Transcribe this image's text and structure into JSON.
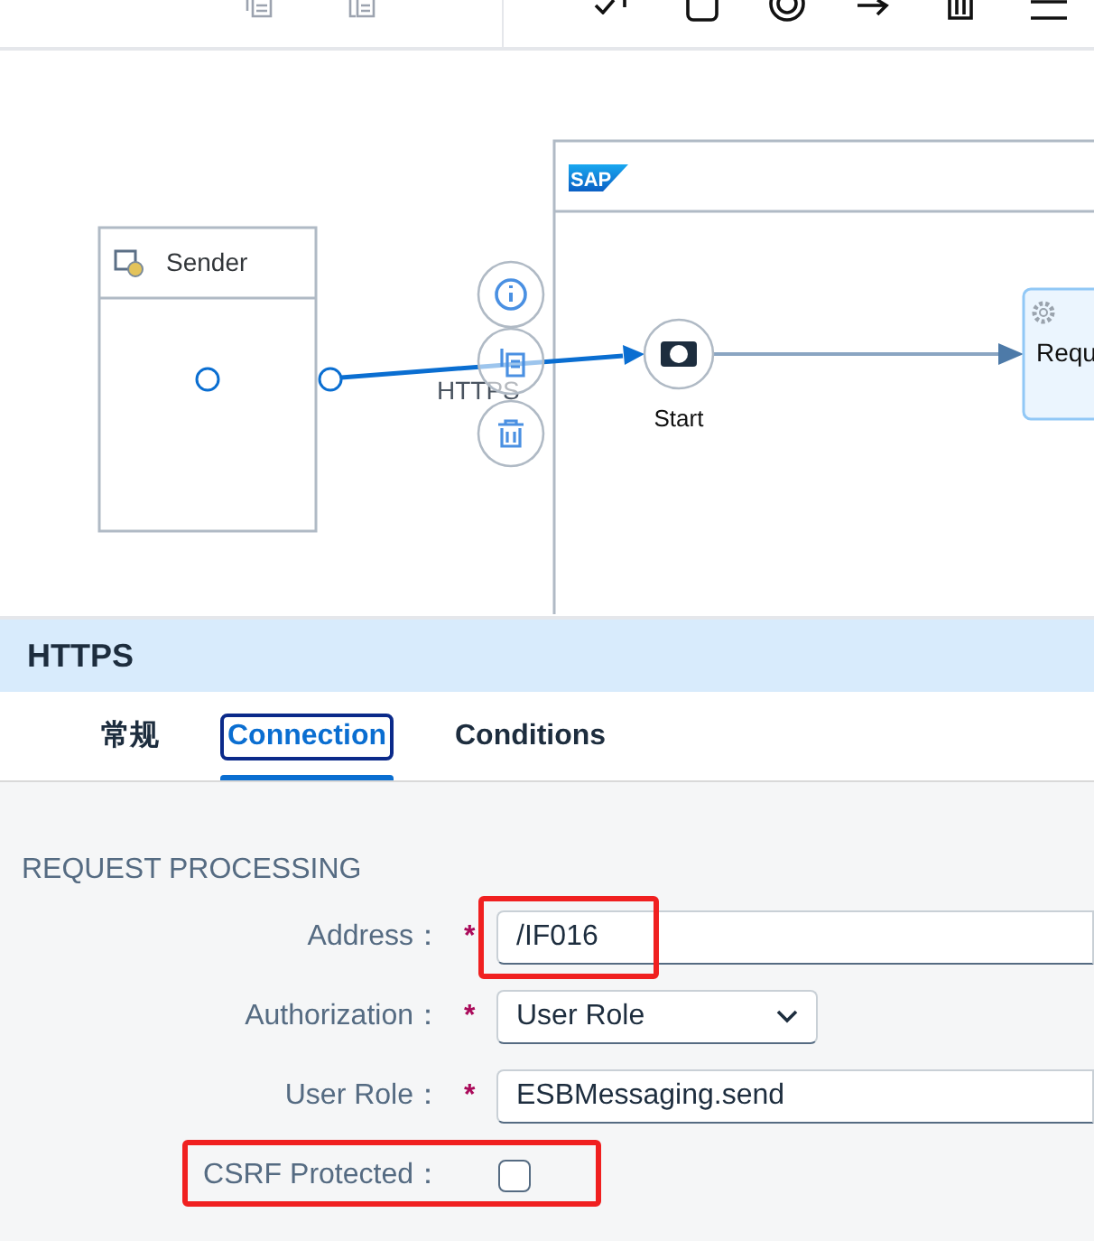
{
  "diagram": {
    "sender": {
      "label": "Sender"
    },
    "connection": {
      "label": "HTTPS"
    },
    "process": {
      "logo": "SAP",
      "start": {
        "label": "Start"
      },
      "step": {
        "label": "Requ"
      }
    }
  },
  "panel": {
    "title": "HTTPS",
    "tabs": [
      {
        "label": "常规",
        "selected": false
      },
      {
        "label": "Connection",
        "selected": true
      },
      {
        "label": "Conditions",
        "selected": false
      }
    ],
    "section": "REQUEST PROCESSING",
    "fields": [
      {
        "kind": "text",
        "label": "Address：",
        "required_mark": "*",
        "value": "/IF016",
        "highlighted": true
      },
      {
        "kind": "select",
        "label": "Authorization：",
        "required_mark": "*",
        "value": "User Role",
        "highlighted": false
      },
      {
        "kind": "text",
        "label": "User Role：",
        "required_mark": "*",
        "value": "ESBMessaging.send",
        "highlighted": false
      },
      {
        "kind": "checkbox",
        "label": "CSRF Protected：",
        "checked": false,
        "highlighted": true
      }
    ]
  }
}
